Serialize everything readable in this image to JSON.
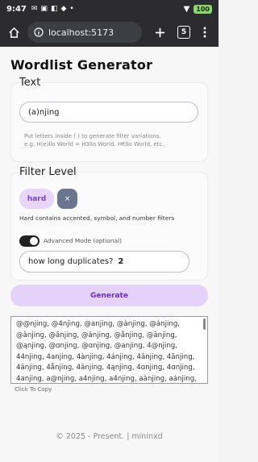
{
  "status": {
    "time": "9:47",
    "battery": "100"
  },
  "browser": {
    "url": "localhost:5173",
    "tab_count": "5"
  },
  "page": {
    "title": "Wordlist Generator"
  },
  "text_card": {
    "title": "Text",
    "input_value": "(a)njing",
    "hint_line1": "Put letters inside ( ) to generate filter variations.",
    "hint_line2": "e.g. H(e)llo World = H3llo World, H€llo World, etc."
  },
  "filter_card": {
    "title": "Filter Level",
    "level": "hard",
    "clear_label": "×",
    "description": "Hard contains accented, symbol, and number filters",
    "advanced_label": "Advanced Mode (optional)",
    "advanced_on": true,
    "dup_label": "how long duplicates?",
    "dup_value": "2"
  },
  "generate_label": "Generate",
  "output_text": "@@njing, @4njing, @anjing, @ànjing, @ánjing, @ânjing, @ãnjing, @änjing, @ånjing, @ānjing, @ąnjing, @ɑnjing, @ɑnjing, @anjing, 4@njing, 44njing, 4anjing, 4ànjing, 4ánjing, 4ânjing, 4ãnjing, 4änjing, 4ånjing, 4ānjing, 4ąnjing, 4ɑnjing, 4ɑnjing, 4anjing, a@njing, a4njing, a4njing, aànjing, aánjing, aânjing, aãnjing",
  "copy_hint": "Click To Copy",
  "footer": "© 2025 - Present. | mininxd"
}
